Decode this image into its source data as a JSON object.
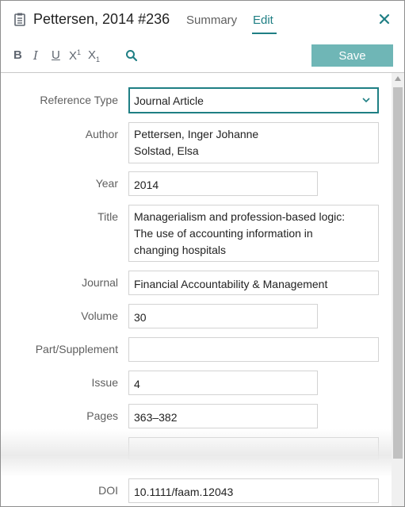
{
  "header": {
    "title": "Pettersen, 2014 #236",
    "tabs": [
      {
        "label": "Summary",
        "active": false
      },
      {
        "label": "Edit",
        "active": true
      }
    ]
  },
  "toolbar": {
    "bold": "B",
    "italic": "I",
    "underline": "U",
    "superscript": "X",
    "superscript_mark": "1",
    "subscript": "X",
    "subscript_mark": "1",
    "save_label": "Save"
  },
  "form": {
    "reference_type": {
      "label": "Reference Type",
      "value": "Journal Article"
    },
    "author": {
      "label": "Author",
      "lines": [
        "Pettersen, Inger Johanne",
        "Solstad, Elsa"
      ]
    },
    "year": {
      "label": "Year",
      "value": "2014"
    },
    "title": {
      "label": "Title",
      "lines": [
        "Managerialism and profession-based logic:",
        "The use of accounting information in",
        "changing hospitals"
      ]
    },
    "journal": {
      "label": "Journal",
      "value": "Financial Accountability & Management"
    },
    "volume": {
      "label": "Volume",
      "value": "30"
    },
    "part_supplement": {
      "label": "Part/Supplement",
      "value": ""
    },
    "issue": {
      "label": "Issue",
      "value": "4"
    },
    "pages": {
      "label": "Pages",
      "value": "363–382"
    },
    "doi": {
      "label": "DOI",
      "value": "10.1111/faam.12043"
    }
  },
  "colors": {
    "accent": "#1f7f84",
    "save_button": "#6fb6b6"
  }
}
